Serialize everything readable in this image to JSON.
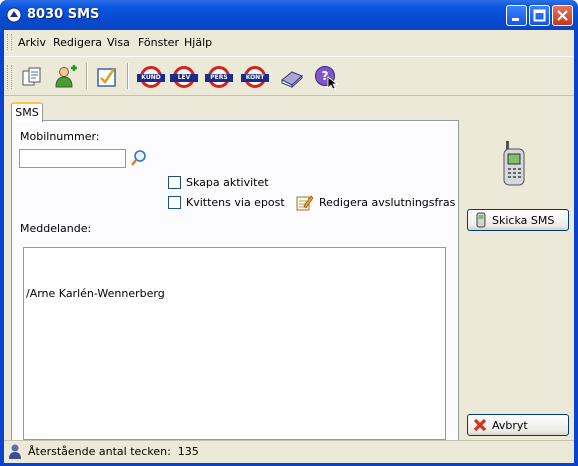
{
  "window": {
    "title": "8030 SMS"
  },
  "menu": [
    "Arkiv",
    "Redigera",
    "Visa",
    "Fönster",
    "Hjälp"
  ],
  "toolbar": {
    "tlc_labels": [
      "KUND",
      "LEV",
      "PERS",
      "KONT"
    ]
  },
  "tabs": [
    "SMS"
  ],
  "form": {
    "mobile_label": "Mobilnummer:",
    "mobile_value": "",
    "create_activity_label": "Skapa aktivitet",
    "create_activity_checked": false,
    "receipt_email_label": "Kvittens via epost",
    "receipt_email_checked": false,
    "edit_closing_label": "Redigera avslutningsfras",
    "message_label": "Meddelande:",
    "message_value": "\n/Arne Karlén-Wennerberg"
  },
  "buttons": {
    "send_sms": "Skicka SMS",
    "cancel": "Avbryt"
  },
  "status": {
    "remaining_chars_text": "Återstående antal tecken:  135"
  },
  "colors": {
    "titlebar_blue": "#0a55df",
    "window_bg": "#ece9d8",
    "roundel_red": "#d3231c",
    "roundel_blue": "#1a2b8c",
    "cancel_x_red": "#d8301c"
  }
}
